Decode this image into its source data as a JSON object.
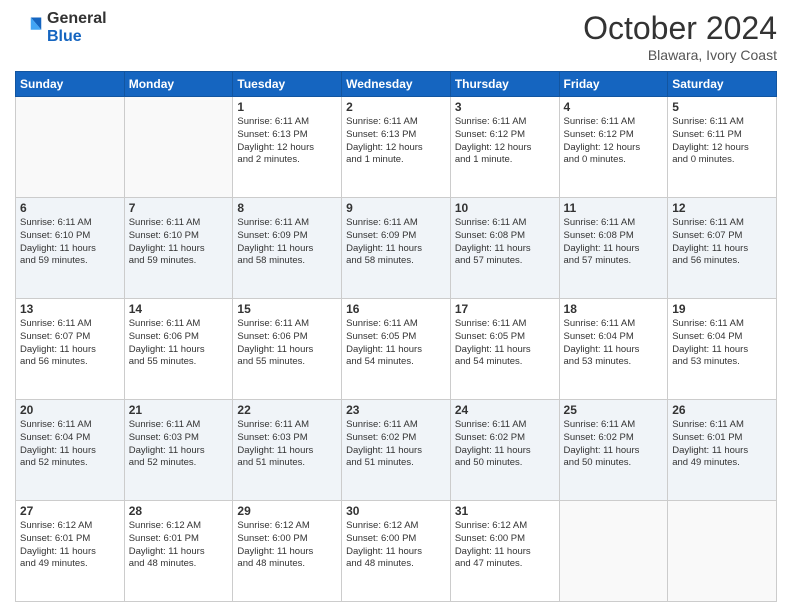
{
  "header": {
    "logo_general": "General",
    "logo_blue": "Blue",
    "title": "October 2024",
    "location": "Blawara, Ivory Coast"
  },
  "days_of_week": [
    "Sunday",
    "Monday",
    "Tuesday",
    "Wednesday",
    "Thursday",
    "Friday",
    "Saturday"
  ],
  "weeks": [
    {
      "days": [
        {
          "num": "",
          "info": ""
        },
        {
          "num": "",
          "info": ""
        },
        {
          "num": "1",
          "info": "Sunrise: 6:11 AM\nSunset: 6:13 PM\nDaylight: 12 hours\nand 2 minutes."
        },
        {
          "num": "2",
          "info": "Sunrise: 6:11 AM\nSunset: 6:13 PM\nDaylight: 12 hours\nand 1 minute."
        },
        {
          "num": "3",
          "info": "Sunrise: 6:11 AM\nSunset: 6:12 PM\nDaylight: 12 hours\nand 1 minute."
        },
        {
          "num": "4",
          "info": "Sunrise: 6:11 AM\nSunset: 6:12 PM\nDaylight: 12 hours\nand 0 minutes."
        },
        {
          "num": "5",
          "info": "Sunrise: 6:11 AM\nSunset: 6:11 PM\nDaylight: 12 hours\nand 0 minutes."
        }
      ]
    },
    {
      "days": [
        {
          "num": "6",
          "info": "Sunrise: 6:11 AM\nSunset: 6:10 PM\nDaylight: 11 hours\nand 59 minutes."
        },
        {
          "num": "7",
          "info": "Sunrise: 6:11 AM\nSunset: 6:10 PM\nDaylight: 11 hours\nand 59 minutes."
        },
        {
          "num": "8",
          "info": "Sunrise: 6:11 AM\nSunset: 6:09 PM\nDaylight: 11 hours\nand 58 minutes."
        },
        {
          "num": "9",
          "info": "Sunrise: 6:11 AM\nSunset: 6:09 PM\nDaylight: 11 hours\nand 58 minutes."
        },
        {
          "num": "10",
          "info": "Sunrise: 6:11 AM\nSunset: 6:08 PM\nDaylight: 11 hours\nand 57 minutes."
        },
        {
          "num": "11",
          "info": "Sunrise: 6:11 AM\nSunset: 6:08 PM\nDaylight: 11 hours\nand 57 minutes."
        },
        {
          "num": "12",
          "info": "Sunrise: 6:11 AM\nSunset: 6:07 PM\nDaylight: 11 hours\nand 56 minutes."
        }
      ]
    },
    {
      "days": [
        {
          "num": "13",
          "info": "Sunrise: 6:11 AM\nSunset: 6:07 PM\nDaylight: 11 hours\nand 56 minutes."
        },
        {
          "num": "14",
          "info": "Sunrise: 6:11 AM\nSunset: 6:06 PM\nDaylight: 11 hours\nand 55 minutes."
        },
        {
          "num": "15",
          "info": "Sunrise: 6:11 AM\nSunset: 6:06 PM\nDaylight: 11 hours\nand 55 minutes."
        },
        {
          "num": "16",
          "info": "Sunrise: 6:11 AM\nSunset: 6:05 PM\nDaylight: 11 hours\nand 54 minutes."
        },
        {
          "num": "17",
          "info": "Sunrise: 6:11 AM\nSunset: 6:05 PM\nDaylight: 11 hours\nand 54 minutes."
        },
        {
          "num": "18",
          "info": "Sunrise: 6:11 AM\nSunset: 6:04 PM\nDaylight: 11 hours\nand 53 minutes."
        },
        {
          "num": "19",
          "info": "Sunrise: 6:11 AM\nSunset: 6:04 PM\nDaylight: 11 hours\nand 53 minutes."
        }
      ]
    },
    {
      "days": [
        {
          "num": "20",
          "info": "Sunrise: 6:11 AM\nSunset: 6:04 PM\nDaylight: 11 hours\nand 52 minutes."
        },
        {
          "num": "21",
          "info": "Sunrise: 6:11 AM\nSunset: 6:03 PM\nDaylight: 11 hours\nand 52 minutes."
        },
        {
          "num": "22",
          "info": "Sunrise: 6:11 AM\nSunset: 6:03 PM\nDaylight: 11 hours\nand 51 minutes."
        },
        {
          "num": "23",
          "info": "Sunrise: 6:11 AM\nSunset: 6:02 PM\nDaylight: 11 hours\nand 51 minutes."
        },
        {
          "num": "24",
          "info": "Sunrise: 6:11 AM\nSunset: 6:02 PM\nDaylight: 11 hours\nand 50 minutes."
        },
        {
          "num": "25",
          "info": "Sunrise: 6:11 AM\nSunset: 6:02 PM\nDaylight: 11 hours\nand 50 minutes."
        },
        {
          "num": "26",
          "info": "Sunrise: 6:11 AM\nSunset: 6:01 PM\nDaylight: 11 hours\nand 49 minutes."
        }
      ]
    },
    {
      "days": [
        {
          "num": "27",
          "info": "Sunrise: 6:12 AM\nSunset: 6:01 PM\nDaylight: 11 hours\nand 49 minutes."
        },
        {
          "num": "28",
          "info": "Sunrise: 6:12 AM\nSunset: 6:01 PM\nDaylight: 11 hours\nand 48 minutes."
        },
        {
          "num": "29",
          "info": "Sunrise: 6:12 AM\nSunset: 6:00 PM\nDaylight: 11 hours\nand 48 minutes."
        },
        {
          "num": "30",
          "info": "Sunrise: 6:12 AM\nSunset: 6:00 PM\nDaylight: 11 hours\nand 48 minutes."
        },
        {
          "num": "31",
          "info": "Sunrise: 6:12 AM\nSunset: 6:00 PM\nDaylight: 11 hours\nand 47 minutes."
        },
        {
          "num": "",
          "info": ""
        },
        {
          "num": "",
          "info": ""
        }
      ]
    }
  ]
}
